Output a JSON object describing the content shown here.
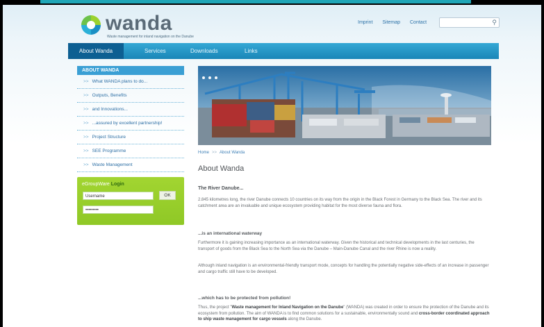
{
  "site": {
    "logo_word": "wanda",
    "logo_subtitle": "Waste management for inland navigation on the Danube",
    "colors": {
      "accent": "#1fa6b7",
      "nav": "#1a86b7",
      "login": "#9bd22e"
    }
  },
  "toplinks": [
    "Imprint",
    "Sitemap",
    "Contact"
  ],
  "search": {
    "placeholder": "",
    "icon": "search-icon"
  },
  "nav": [
    "About Wanda",
    "Services",
    "Downloads",
    "Links"
  ],
  "sidebar": {
    "heading": "ABOUT WANDA",
    "items": [
      "What WANDA plans to do...",
      "Outputs, Benefits",
      "and Innovations...",
      "...assured by excellent partnership!",
      "Project Structure",
      "SEE Programme",
      "Waste Management"
    ]
  },
  "login": {
    "title_a": "eGroupWare",
    "title_b": "Login",
    "username": "Username",
    "password": "•••••••••",
    "ok": "OK"
  },
  "breadcrumb": {
    "home": "Home",
    "sep": ">>",
    "current": "About Wanda"
  },
  "content": {
    "title": "About Wanda",
    "section1_heading": "The River Danube...",
    "section1_text": "2.845 kilometres long, the river Danube connects 10 countries on its way from the origin in the Black Forest in Germany to the Black Sea. The river and its catchment area are an invaluable and unique ecosystem providing habitat for the most diverse fauna and flora.",
    "section2_heading": "...is an international waterway",
    "section2_text1": "Furthermore it is gaining increasing importance as an international waterway. Given the historical and technical developments in the last centuries, the transport of goods from the Black Sea to the North Sea via the Danube – Main-Danube Canal and the river Rhine is now a reality.",
    "section2_text2": "Although inland navigation is an environmental-friendly transport mode, concepts for handling the potentially negative side-effects of an increase in passenger and cargo traffic still have to be developed.",
    "section3_heading": "...which has to be protected from pollution!",
    "section3_text_a": "Thus, the project \"",
    "section3_bold1": "Waste management for Inland Navigation on the Danube",
    "section3_text_b": "\" (WANDA) was created in order to ensure the protection of the Danube and its ecosystem from pollution. The aim of WANDA is to find common solutions for a sustainable, environmentally sound and ",
    "section3_bold2": "cross-border coordinated approach to ship waste management for cargo vessels",
    "section3_text_c": " along the Danube."
  }
}
